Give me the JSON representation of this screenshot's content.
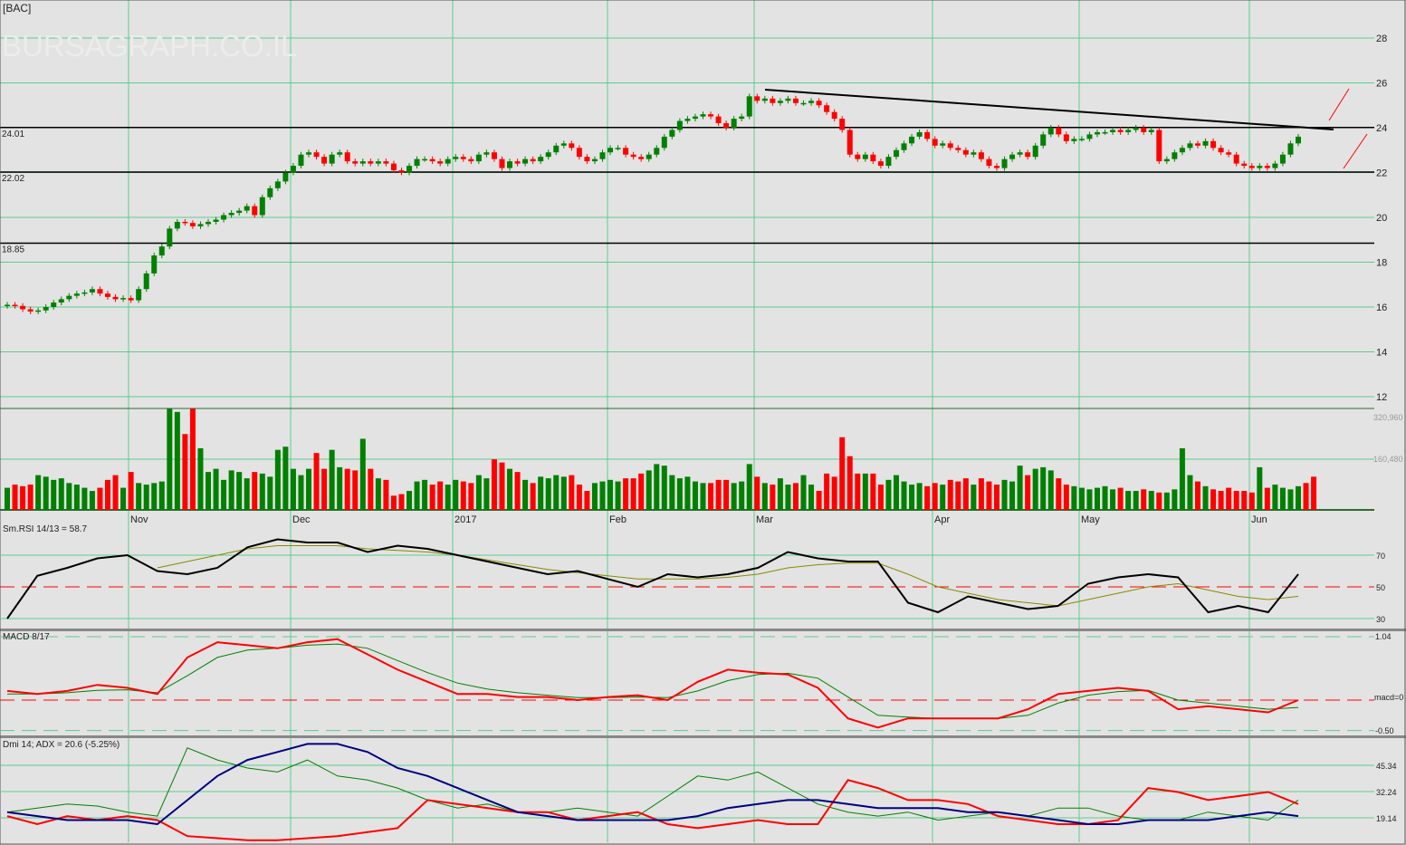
{
  "chart_data": {
    "type": "candlestick",
    "symbol_label": "[BAC]",
    "watermark": "BURSAGRAPH.CO.IL",
    "price_axis": {
      "ticks": [
        "28",
        "26",
        "24",
        "22",
        "20",
        "18",
        "16",
        "14",
        "12"
      ],
      "ylim": [
        12,
        28
      ]
    },
    "levels": [
      {
        "value": 24.01,
        "label": "24.01"
      },
      {
        "value": 22.02,
        "label": "22.02"
      },
      {
        "value": 18.85,
        "label": "18.85"
      }
    ],
    "months": [
      "Nov",
      "Dec",
      "2017",
      "Feb",
      "Mar",
      "Apr",
      "May",
      "Jun"
    ],
    "month_start_bars": [
      16,
      37,
      58,
      78,
      97,
      120,
      139,
      161
    ],
    "closes": [
      16.1,
      16.05,
      15.9,
      15.8,
      15.85,
      16.0,
      16.2,
      16.35,
      16.5,
      16.6,
      16.65,
      16.8,
      16.6,
      16.45,
      16.35,
      16.4,
      16.3,
      16.8,
      17.5,
      18.3,
      18.7,
      19.5,
      19.8,
      19.75,
      19.6,
      19.7,
      19.8,
      19.9,
      20.1,
      20.2,
      20.3,
      20.5,
      20.1,
      20.9,
      21.3,
      21.6,
      22.0,
      22.3,
      22.8,
      22.9,
      22.7,
      22.4,
      22.8,
      22.9,
      22.5,
      22.4,
      22.5,
      22.4,
      22.5,
      22.4,
      22.1,
      22.0,
      22.3,
      22.6,
      22.6,
      22.5,
      22.4,
      22.6,
      22.7,
      22.6,
      22.5,
      22.8,
      22.9,
      22.6,
      22.2,
      22.5,
      22.4,
      22.6,
      22.5,
      22.7,
      22.9,
      23.2,
      23.3,
      23.1,
      22.7,
      22.5,
      22.6,
      22.9,
      23.1,
      23.1,
      22.8,
      22.7,
      22.6,
      22.8,
      23.1,
      23.6,
      23.9,
      24.3,
      24.4,
      24.5,
      24.6,
      24.5,
      24.2,
      24.0,
      24.4,
      24.5,
      25.4,
      25.2,
      25.3,
      25.1,
      25.2,
      25.3,
      25.1,
      25.1,
      25.2,
      25.0,
      24.7,
      24.4,
      23.9,
      22.8,
      22.6,
      22.8,
      22.5,
      22.3,
      22.7,
      23.0,
      23.3,
      23.6,
      23.8,
      23.5,
      23.2,
      23.3,
      23.1,
      23.0,
      22.8,
      22.9,
      22.6,
      22.3,
      22.2,
      22.6,
      22.8,
      22.9,
      22.7,
      23.2,
      23.7,
      24.0,
      23.7,
      23.4,
      23.5,
      23.5,
      23.7,
      23.8,
      23.8,
      23.9,
      23.8,
      23.9,
      24.0,
      23.8,
      23.9,
      22.5,
      22.6,
      22.9,
      23.1,
      23.3,
      23.2,
      23.4,
      23.1,
      22.9,
      22.8,
      22.4,
      22.3,
      22.2,
      22.3,
      22.2,
      22.4,
      22.8,
      23.3,
      23.6
    ],
    "volume": {
      "axis_labels": [
        "320,960",
        "160,480"
      ],
      "axis_values": [
        320960,
        160480
      ],
      "values_k": [
        70,
        80,
        75,
        80,
        110,
        105,
        95,
        100,
        85,
        80,
        70,
        60,
        70,
        95,
        110,
        70,
        120,
        85,
        80,
        85,
        90,
        320,
        310,
        240,
        320,
        195,
        120,
        130,
        95,
        125,
        120,
        100,
        120,
        115,
        105,
        190,
        200,
        130,
        110,
        130,
        180,
        130,
        190,
        135,
        130,
        125,
        225,
        130,
        100,
        95,
        45,
        50,
        60,
        90,
        95,
        80,
        90,
        80,
        95,
        90,
        85,
        110,
        100,
        160,
        150,
        130,
        120,
        95,
        85,
        105,
        100,
        110,
        105,
        110,
        80,
        60,
        85,
        90,
        95,
        90,
        100,
        100,
        115,
        125,
        145,
        140,
        110,
        100,
        105,
        90,
        85,
        85,
        95,
        95,
        85,
        90,
        145,
        105,
        85,
        80,
        100,
        80,
        85,
        110,
        80,
        60,
        115,
        105,
        230,
        170,
        115,
        115,
        115,
        80,
        95,
        110,
        90,
        80,
        85,
        75,
        85,
        80,
        95,
        90,
        100,
        80,
        100,
        90,
        80,
        95,
        90,
        140,
        110,
        130,
        135,
        125,
        100,
        80,
        75,
        70,
        65,
        70,
        75,
        65,
        70,
        60,
        60,
        65,
        60,
        55,
        55,
        65,
        195,
        110,
        90,
        75,
        65,
        60,
        70,
        60,
        60,
        55,
        135,
        70,
        80,
        70,
        65,
        75,
        85,
        105
      ]
    },
    "rsi": {
      "label": "Sm.RSI 14/13 = 58.7",
      "ticks": [
        "70",
        "50",
        "30"
      ],
      "values": [
        30,
        57,
        62,
        68,
        70,
        60,
        58,
        62,
        75,
        80,
        78,
        78,
        72,
        76,
        74,
        70,
        66,
        62,
        58,
        60,
        55,
        50,
        58,
        56,
        58,
        62,
        72,
        68,
        66,
        66,
        40,
        34,
        44,
        40,
        36,
        38,
        52,
        56,
        58,
        56,
        34,
        38,
        34,
        58
      ],
      "signal": [
        null,
        null,
        null,
        null,
        null,
        62,
        66,
        70,
        74,
        76,
        76,
        76,
        74,
        73,
        72,
        70,
        67,
        64,
        61,
        59,
        57,
        55,
        55,
        55,
        56,
        58,
        62,
        64,
        65,
        65,
        58,
        50,
        46,
        42,
        40,
        38,
        42,
        46,
        50,
        52,
        48,
        44,
        42,
        44
      ]
    },
    "macd": {
      "label": "MACD 8/17",
      "ticks": [
        "1.04",
        "macd=0",
        "-0.50"
      ],
      "values": [
        0.15,
        0.1,
        0.15,
        0.25,
        0.2,
        0.1,
        0.7,
        0.95,
        0.9,
        0.85,
        0.95,
        1.0,
        0.75,
        0.5,
        0.3,
        0.1,
        0.1,
        0.05,
        0.05,
        0.0,
        0.05,
        0.08,
        0.0,
        0.3,
        0.5,
        0.45,
        0.42,
        0.2,
        -0.3,
        -0.45,
        -0.3,
        -0.3,
        -0.3,
        -0.3,
        -0.15,
        0.1,
        0.15,
        0.2,
        0.15,
        -0.15,
        -0.1,
        -0.15,
        -0.2,
        0.0
      ],
      "signal": [
        0.1,
        0.1,
        0.12,
        0.16,
        0.17,
        0.12,
        0.4,
        0.7,
        0.82,
        0.85,
        0.9,
        0.92,
        0.85,
        0.65,
        0.45,
        0.28,
        0.18,
        0.12,
        0.08,
        0.04,
        0.04,
        0.05,
        0.04,
        0.15,
        0.32,
        0.42,
        0.44,
        0.36,
        0.05,
        -0.25,
        -0.28,
        -0.3,
        -0.3,
        -0.3,
        -0.25,
        -0.05,
        0.08,
        0.14,
        0.16,
        0.0,
        -0.05,
        -0.1,
        -0.15,
        -0.12
      ]
    },
    "dmi": {
      "label": "Dmi 14; ADX = 20.6 (-5.25%)",
      "ticks": [
        "45.34",
        "32.24",
        "19.14"
      ],
      "plus_di": [
        22,
        24,
        26,
        25,
        22,
        20,
        54,
        48,
        44,
        42,
        48,
        40,
        38,
        34,
        28,
        24,
        26,
        22,
        22,
        24,
        22,
        20,
        30,
        40,
        38,
        42,
        34,
        26,
        22,
        20,
        22,
        18,
        20,
        22,
        20,
        24,
        24,
        20,
        18,
        18,
        22,
        20,
        18,
        28
      ],
      "minus_di": [
        20,
        16,
        20,
        18,
        20,
        18,
        10,
        9,
        8,
        8,
        9,
        10,
        12,
        14,
        28,
        26,
        24,
        22,
        22,
        18,
        20,
        22,
        16,
        14,
        16,
        18,
        16,
        16,
        38,
        34,
        28,
        28,
        26,
        20,
        18,
        16,
        16,
        18,
        34,
        32,
        28,
        30,
        32,
        26
      ],
      "adx": [
        22,
        20,
        18,
        18,
        18,
        16,
        28,
        40,
        48,
        52,
        56,
        56,
        52,
        44,
        40,
        34,
        28,
        22,
        20,
        18,
        18,
        18,
        18,
        20,
        24,
        26,
        28,
        28,
        26,
        24,
        24,
        24,
        22,
        22,
        20,
        18,
        16,
        16,
        18,
        18,
        18,
        20,
        22,
        20
      ]
    },
    "colors": {
      "up": "#008000",
      "down": "#ff0000",
      "grid": "#5ccc8c",
      "bg": "#e3e3e3"
    }
  }
}
